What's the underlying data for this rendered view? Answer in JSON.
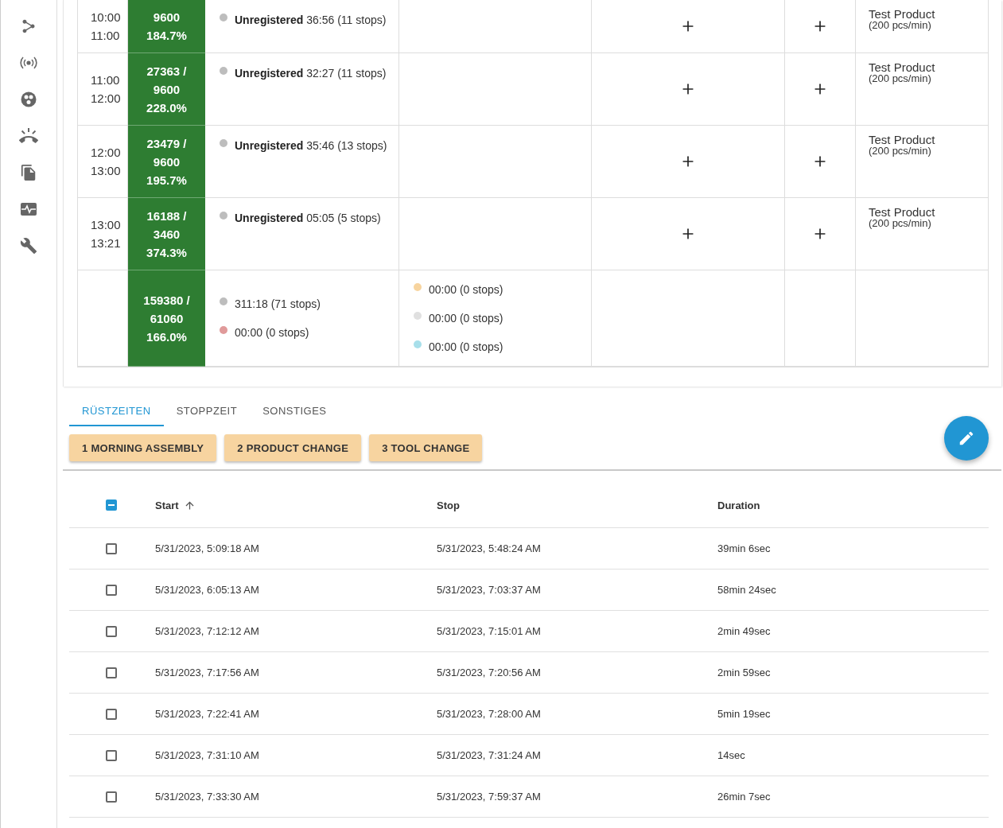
{
  "sidebar": {
    "items": [
      {
        "kind": "nodes"
      },
      {
        "kind": "broadcast"
      },
      {
        "kind": "circles"
      },
      {
        "kind": "phone"
      },
      {
        "kind": "copy"
      },
      {
        "kind": "monitor"
      },
      {
        "kind": "wrench"
      }
    ]
  },
  "hourly_table": {
    "rows": [
      {
        "kind": "hour",
        "time_start": "10:00",
        "time_end": "11:00",
        "output": [
          "9600",
          "184.7%"
        ],
        "stops": [
          {
            "color": "#bdbdbd",
            "text": "**Unregistered** 36:56 (11 stops)"
          }
        ],
        "product_name": "Test Product",
        "product_rate": "(200 pcs/min)"
      },
      {
        "kind": "hour",
        "time_start": "11:00",
        "time_end": "12:00",
        "output": [
          "27363 /",
          "9600",
          "228.0%"
        ],
        "stops": [
          {
            "color": "#bdbdbd",
            "text": "**Unregistered** 32:27 (11 stops)"
          }
        ],
        "product_name": "Test Product",
        "product_rate": "(200 pcs/min)"
      },
      {
        "kind": "hour",
        "time_start": "12:00",
        "time_end": "13:00",
        "output": [
          "23479 /",
          "9600",
          "195.7%"
        ],
        "stops": [
          {
            "color": "#bdbdbd",
            "text": "**Unregistered** 35:46 (13 stops)"
          }
        ],
        "product_name": "Test Product",
        "product_rate": "(200 pcs/min)"
      },
      {
        "kind": "hour",
        "time_start": "13:00",
        "time_end": "13:21",
        "output": [
          "16188 /",
          "3460",
          "374.3%"
        ],
        "stops": [
          {
            "color": "#bdbdbd",
            "text": "**Unregistered** 05:05 (5 stops)"
          }
        ],
        "product_name": "Test Product",
        "product_rate": "(200 pcs/min)"
      },
      {
        "kind": "total",
        "output": [
          "159380 /",
          "61060",
          "166.0%"
        ],
        "stops": [
          {
            "color": "#bdbdbd",
            "text": "311:18 (71 stops)"
          },
          {
            "color": "#e09a9a",
            "text": "00:00 (0 stops)"
          }
        ],
        "setup_stops": [
          {
            "color": "#f7d49f",
            "text": "00:00 (0 stops)"
          },
          {
            "color": "#e0e0e0",
            "text": "00:00 (0 stops)"
          },
          {
            "color": "#a8dfea",
            "text": "00:00 (0 stops)"
          }
        ]
      }
    ]
  },
  "tabs": [
    {
      "label": "RÜSTZEITEN",
      "selected": true
    },
    {
      "label": "STOPPZEIT",
      "selected": false
    },
    {
      "label": "SONSTIGES",
      "selected": false
    }
  ],
  "reason_buttons": [
    "1 MORNING ASSEMBLY",
    "2 PRODUCT CHANGE",
    "3 TOOL CHANGE"
  ],
  "records_table": {
    "select_all": {
      "indeterminate": true
    },
    "columns": [
      {
        "label": "Start",
        "sorted": true
      },
      {
        "label": "Stop",
        "sorted": false
      },
      {
        "label": "Duration",
        "sorted": false
      }
    ],
    "rows": [
      {
        "selected": false,
        "start": "5/31/2023, 5:09:18 AM",
        "stop": "5/31/2023, 5:48:24 AM",
        "duration": "39min 6sec"
      },
      {
        "selected": false,
        "start": "5/31/2023, 6:05:13 AM",
        "stop": "5/31/2023, 7:03:37 AM",
        "duration": "58min 24sec"
      },
      {
        "selected": false,
        "start": "5/31/2023, 7:12:12 AM",
        "stop": "5/31/2023, 7:15:01 AM",
        "duration": "2min 49sec"
      },
      {
        "selected": false,
        "start": "5/31/2023, 7:17:56 AM",
        "stop": "5/31/2023, 7:20:56 AM",
        "duration": "2min 59sec"
      },
      {
        "selected": false,
        "start": "5/31/2023, 7:22:41 AM",
        "stop": "5/31/2023, 7:28:00 AM",
        "duration": "5min 19sec"
      },
      {
        "selected": false,
        "start": "5/31/2023, 7:31:10 AM",
        "stop": "5/31/2023, 7:31:24 AM",
        "duration": "14sec"
      },
      {
        "selected": false,
        "start": "5/31/2023, 7:33:30 AM",
        "stop": "5/31/2023, 7:59:37 AM",
        "duration": "26min 7sec"
      }
    ]
  }
}
